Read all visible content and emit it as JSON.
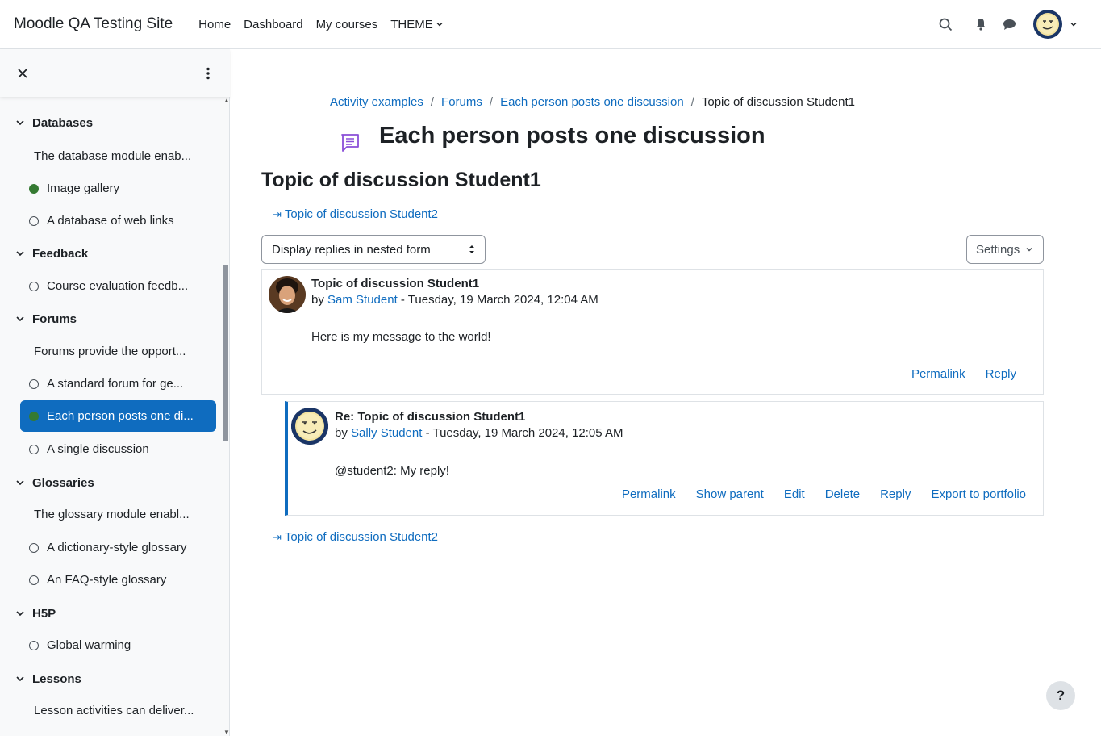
{
  "navbar": {
    "brand": "Moodle QA Testing Site",
    "links": [
      "Home",
      "Dashboard",
      "My courses",
      "THEME"
    ],
    "icons": [
      "search-icon",
      "bell-icon",
      "chat-icon"
    ],
    "user_avatar": "smiley-avatar"
  },
  "drawer": {
    "sections": [
      {
        "label": "Databases"
      },
      {
        "label": "Feedback"
      },
      {
        "label": "Forums"
      },
      {
        "label": "Glossaries"
      },
      {
        "label": "H5P"
      },
      {
        "label": "Lessons"
      }
    ],
    "items": [
      {
        "label": "The database module enab...",
        "kind": "summary"
      },
      {
        "label": "Image gallery",
        "kind": "done"
      },
      {
        "label": "A database of web links",
        "kind": "todo"
      },
      {
        "label": "Course evaluation feedb...",
        "kind": "todo"
      },
      {
        "label": "Forums provide the opport...",
        "kind": "summary"
      },
      {
        "label": "A standard forum for ge...",
        "kind": "todo"
      },
      {
        "label": "Each person posts one di...",
        "kind": "active"
      },
      {
        "label": "A single discussion",
        "kind": "todo"
      },
      {
        "label": "The glossary module enabl...",
        "kind": "summary"
      },
      {
        "label": "A dictionary-style glossary",
        "kind": "todo"
      },
      {
        "label": "An FAQ-style glossary",
        "kind": "todo"
      },
      {
        "label": "Global warming",
        "kind": "todo"
      },
      {
        "label": "Lesson activities can deliver...",
        "kind": "summary"
      }
    ]
  },
  "breadcrumb": {
    "items": [
      "Activity examples",
      "Forums",
      "Each person posts one discussion"
    ],
    "current": "Topic of discussion Student1"
  },
  "page": {
    "title": "Each person posts one discussion",
    "discussion_title": "Topic of discussion Student1",
    "next_discussion": "Topic of discussion Student2",
    "display_mode": "Display replies in nested form",
    "settings_label": "Settings"
  },
  "posts": [
    {
      "title": "Topic of discussion Student1",
      "by_prefix": "by",
      "author": "Sam Student",
      "date": "- Tuesday, 19 March 2024, 12:04 AM",
      "message": "Here is my message to the world!",
      "actions": [
        "Permalink",
        "Reply"
      ]
    },
    {
      "title": "Re: Topic of discussion Student1",
      "by_prefix": "by",
      "author": "Sally Student",
      "date": "- Tuesday, 19 March 2024, 12:05 AM",
      "message": "@student2: My reply!",
      "actions": [
        "Permalink",
        "Show parent",
        "Edit",
        "Delete",
        "Reply",
        "Export to portfolio"
      ]
    }
  ],
  "help_label": "?",
  "colors": {
    "link": "#0f6cbf",
    "active_bg": "#0f6cbf",
    "done_dot": "#357a32",
    "forum_icon": "#8a4fd8"
  }
}
